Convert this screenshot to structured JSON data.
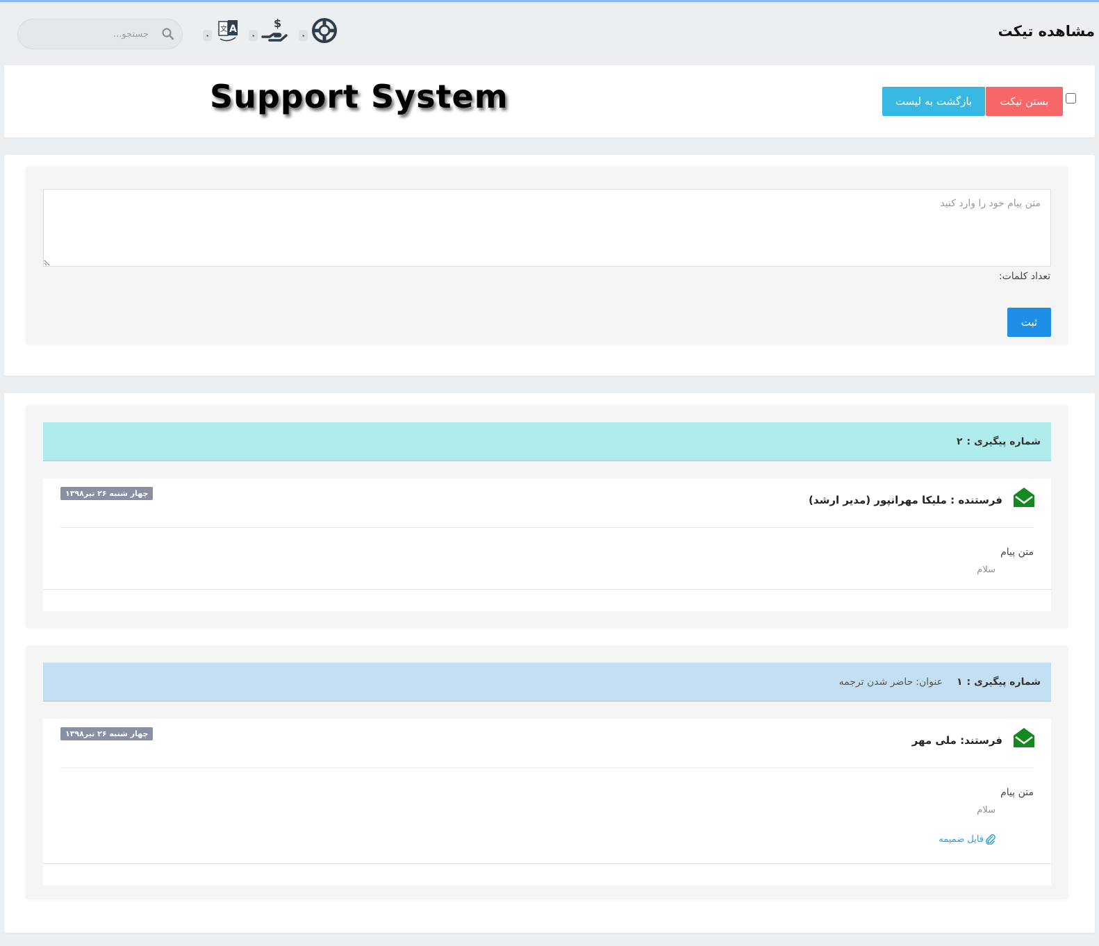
{
  "header": {
    "title": "مشاهده تیکت",
    "search_placeholder": "جستجو...",
    "icons": [
      {
        "name": "support-lifebuoy-icon",
        "count": "۰"
      },
      {
        "name": "payment-hand-icon",
        "count": "۰"
      },
      {
        "name": "translate-icon",
        "count": "۰"
      }
    ]
  },
  "toolbar": {
    "banner": "Support System",
    "close_label": "بستن تیکت",
    "back_label": "بازگشت به لیست"
  },
  "reply_form": {
    "placeholder": "متن پیام خود را وارد کنید",
    "word_count_label": "تعداد کلمات:",
    "submit_label": "ثبت"
  },
  "threads": [
    {
      "track_label": "شماره پیگیری :",
      "track_number": "۲",
      "subject_label": "",
      "subject": "",
      "color": "#b1ecec",
      "sender": "فرستنده : ملیکا مهرانپور (مدیر ارشد)",
      "date": "چهار شنبه ۲۶ تیر۱۳۹۸",
      "body_label": "متن پیام",
      "body": "سلام",
      "attachment": ""
    },
    {
      "track_label": "شماره پیگیری :",
      "track_number": "۱",
      "subject_label": "عنوان:",
      "subject": "حاضر شدن ترجمه",
      "color": "#c4dff2",
      "sender": "فرستند: ملی مهر",
      "date": "چهار شنبه ۲۶ تیر۱۳۹۸",
      "body_label": "متن پیام",
      "body": "سلام",
      "attachment": "فایل ضمیمه"
    }
  ],
  "colors": {
    "close_button": "#f76767",
    "back_button": "#37b8e3",
    "submit_button": "#1f8fe6",
    "mail_icon": "#138a1f"
  }
}
